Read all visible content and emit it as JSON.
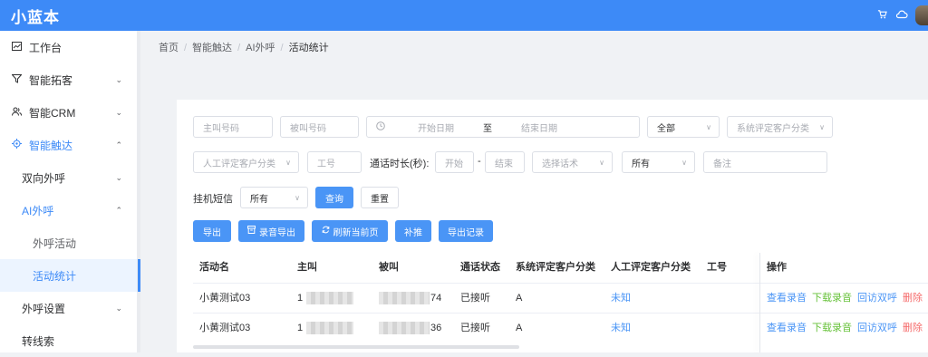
{
  "app": {
    "title": "小蓝本"
  },
  "topbar": {
    "icons": [
      "cart-icon",
      "cloud-icon",
      "avatar"
    ]
  },
  "sidebar": {
    "items": [
      {
        "label": "工作台",
        "icon": "dashboard-icon",
        "chevron": false
      },
      {
        "label": "智能拓客",
        "icon": "filter-icon",
        "chevron": true
      },
      {
        "label": "智能CRM",
        "icon": "users-icon",
        "chevron": true
      },
      {
        "label": "智能触达",
        "icon": "target-icon",
        "chevron": true,
        "expanded": true
      },
      {
        "label": "双向外呼",
        "chevron": true
      },
      {
        "label": "AI外呼",
        "chevron": true,
        "expanded": true
      },
      {
        "label": "外呼活动"
      },
      {
        "label": "活动统计",
        "selected": true
      },
      {
        "label": "外呼设置",
        "chevron": true
      },
      {
        "label": "转线索"
      }
    ]
  },
  "breadcrumb": [
    "首页",
    "智能触达",
    "AI外呼",
    "活动统计"
  ],
  "filters": {
    "caller_placeholder": "主叫号码",
    "callee_placeholder": "被叫号码",
    "start_date_placeholder": "开始日期",
    "date_sep": "至",
    "end_date_placeholder": "结束日期",
    "status_value": "全部",
    "sys_class_placeholder": "系统评定客户分类",
    "manual_class_placeholder": "人工评定客户分类",
    "job_no_placeholder": "工号",
    "duration_label": "通话时长(秒):",
    "duration_start_placeholder": "开始",
    "duration_sep": "-",
    "duration_end_placeholder": "结束",
    "script_placeholder": "选择话术",
    "scope_value": "所有",
    "note_placeholder": "备注",
    "sms_label": "挂机短信",
    "sms_value": "所有",
    "query_label": "查询",
    "reset_label": "重置"
  },
  "actions": {
    "export": "导出",
    "export_audio": "录音导出",
    "refresh": "刷新当前页",
    "supplement": "补推",
    "export_log": "导出记录"
  },
  "table": {
    "columns": [
      "活动名",
      "主叫",
      "被叫",
      "通话状态",
      "系统评定客户分类",
      "人工评定客户分类",
      "工号",
      "操作"
    ],
    "rows": [
      {
        "name": "小黄测试03",
        "caller": "1",
        "callee_tail": "74",
        "status": "已接听",
        "sys_class": "A",
        "manual_class": "未知",
        "job_no": ""
      },
      {
        "name": "小黄测试03",
        "caller": "1",
        "callee_tail": "36",
        "status": "已接听",
        "sys_class": "A",
        "manual_class": "未知",
        "job_no": ""
      }
    ],
    "row_actions": [
      "查看录音",
      "下载录音",
      "回访双呼",
      "删除"
    ]
  },
  "colors": {
    "primary": "#3d8af7",
    "link": "#4a95f6",
    "success": "#67c23a",
    "danger": "#f56c6c"
  }
}
